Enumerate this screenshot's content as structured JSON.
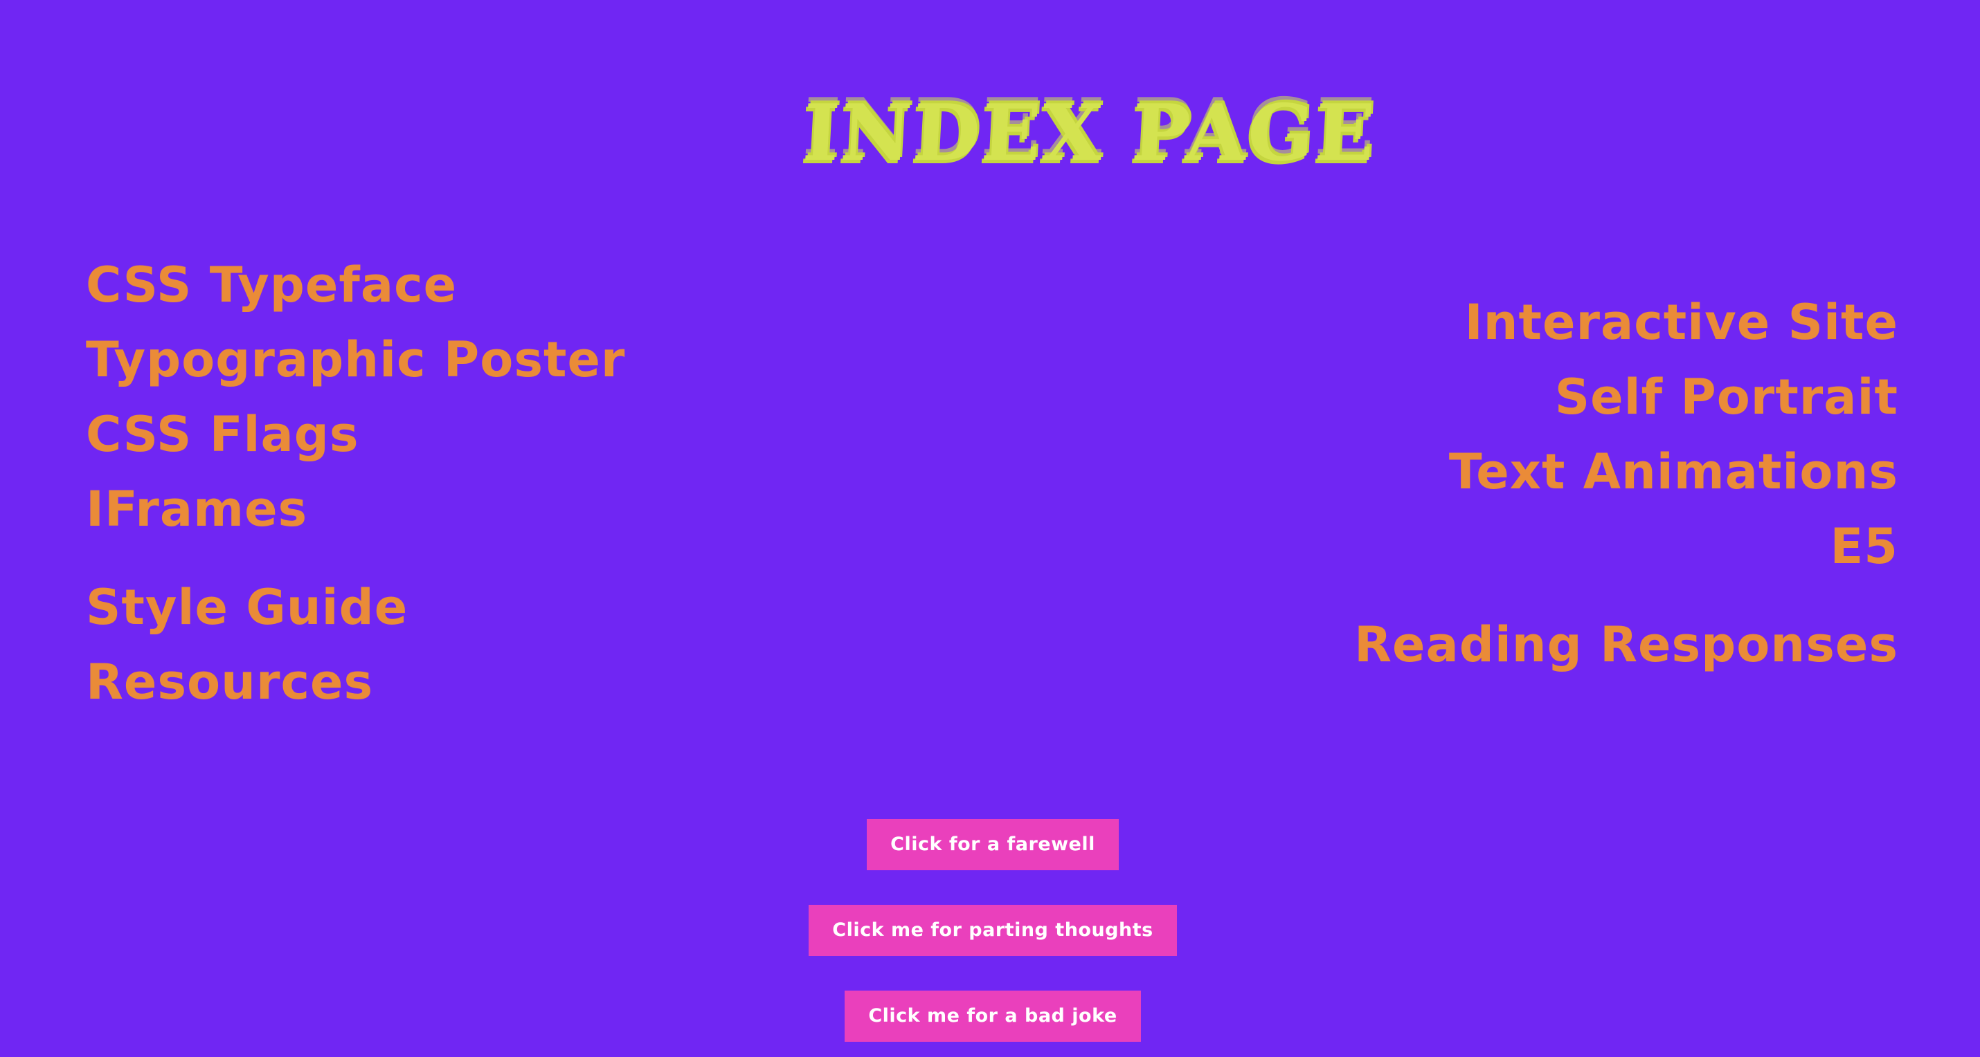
{
  "header": {
    "title": "INDEX PAGE"
  },
  "nav_left": [
    {
      "label": "CSS Typeface"
    },
    {
      "label": "Typographic Poster"
    },
    {
      "label": "CSS Flags"
    },
    {
      "label": "IFrames"
    },
    {
      "label": "Style Guide"
    },
    {
      "label": "Resources"
    }
  ],
  "nav_right": [
    {
      "label": "Interactive Site"
    },
    {
      "label": "Self Portrait"
    },
    {
      "label": "Text Animations"
    },
    {
      "label": "E5"
    },
    {
      "label": "Reading Responses"
    }
  ],
  "buttons": {
    "farewell": "Click for a farewell",
    "parting_thoughts": "Click me for parting thoughts",
    "bad_joke": "Click me for a bad joke"
  },
  "colors": {
    "background": "#7026f3",
    "title": "#d4e350",
    "link": "#ea8b38",
    "button": "#ea40bc",
    "button_text": "#ffffff"
  }
}
